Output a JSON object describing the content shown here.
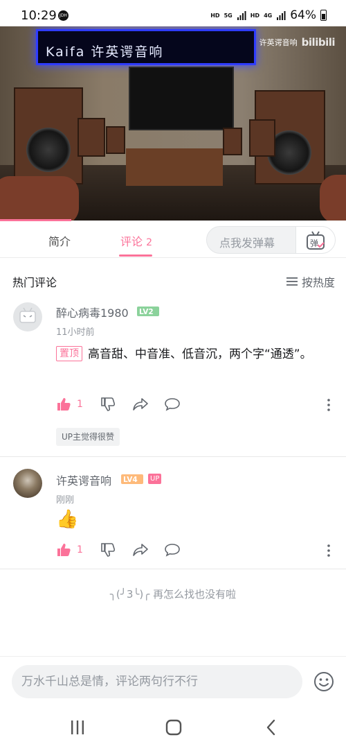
{
  "status_bar": {
    "time": "10:29",
    "jdh_badge": "JDH",
    "net_hd1": "HD",
    "net_5g": "5G",
    "net_hd2": "HD",
    "net_4g": "4G",
    "battery": "64%"
  },
  "video": {
    "sign_text": "Kaifa 许英谔音响",
    "watermark_channel": "许英谔音响",
    "watermark_logo": "bilibili",
    "progress_percent": 20.6
  },
  "tabs": {
    "intro": "简介",
    "comments": "评论",
    "comments_count": "2",
    "danmaku_placeholder": "点我发弹幕",
    "danmaku_button": "弹"
  },
  "hot_header": {
    "title": "热门评论",
    "sort_label": "按热度"
  },
  "comments": [
    {
      "username": "醉心病毒1980",
      "level": "LV2",
      "time": "11小时前",
      "pinned_label": "置顶",
      "text": "高音甜、中音准、低音沉，两个字“通透”。",
      "like_count": "1",
      "up_liked": "UP主觉得很赞"
    },
    {
      "username": "许英谔音响",
      "level": "LV4",
      "badge": "UP",
      "time": "刚刚",
      "text": "👍",
      "like_count": "1"
    }
  ],
  "end_message": {
    "face": "╮(╯3╰)╭",
    "text": "再怎么找也没有啦"
  },
  "comment_input": {
    "placeholder": "万水千山总是情，评论两句行不行"
  },
  "colors": {
    "accent": "#fb7299",
    "level2": "#8bd29b",
    "level4": "#feba7a",
    "muted": "#9499a0"
  },
  "icons": [
    "thumb-up-icon",
    "thumb-down-icon",
    "share-icon",
    "reply-icon",
    "more-icon",
    "sort-icon",
    "emoji-icon",
    "danmaku-icon"
  ]
}
